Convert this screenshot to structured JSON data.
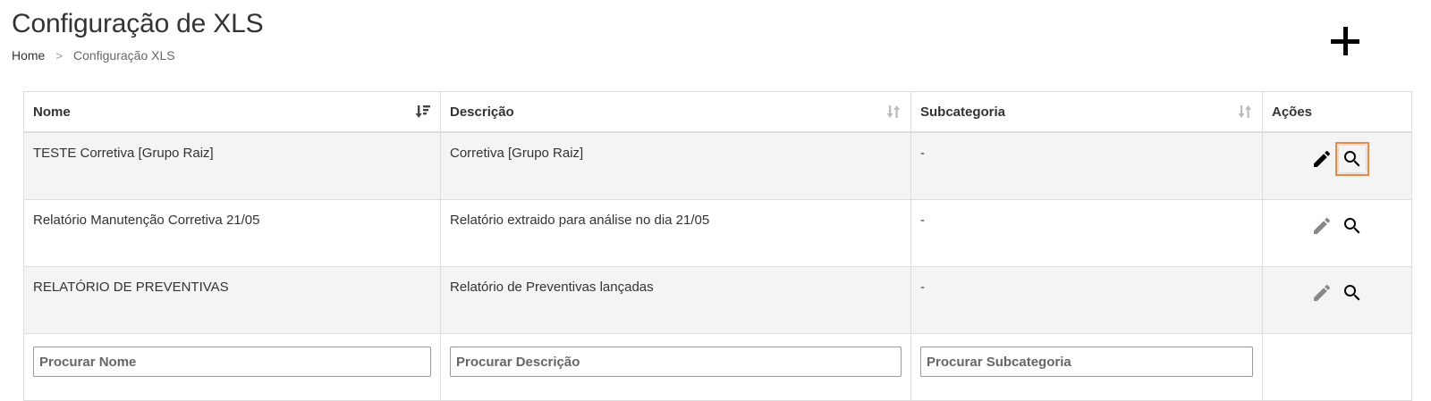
{
  "header": {
    "title": "Configuração de XLS",
    "breadcrumb": {
      "home": "Home",
      "separator": ">",
      "current": "Configuração XLS"
    }
  },
  "actions": {
    "add_icon": "plus-icon"
  },
  "table": {
    "columns": [
      {
        "label": "Nome",
        "sort": "sorted-descending"
      },
      {
        "label": "Descrição",
        "sort": "unsorted"
      },
      {
        "label": "Subcategoria",
        "sort": "unsorted"
      },
      {
        "label": "Ações",
        "sort": "none"
      }
    ],
    "rows": [
      {
        "nome": "TESTE Corretiva [Grupo Raiz]",
        "descricao": "Corretiva [Grupo Raiz]",
        "subcategoria": "-"
      },
      {
        "nome": "Relatório Manutenção Corretiva 21/05",
        "descricao": "Relatório extraido para análise no dia 21/05",
        "subcategoria": "-"
      },
      {
        "nome": "RELATÓRIO DE PREVENTIVAS",
        "descricao": "Relatório de Preventivas lançadas",
        "subcategoria": "-"
      }
    ],
    "row_actions": {
      "edit_icon": "pencil-icon",
      "view_icon": "search-icon"
    },
    "filters": {
      "nome_placeholder": "Procurar Nome",
      "descricao_placeholder": "Procurar Descrição",
      "subcategoria_placeholder": "Procurar Subcategoria"
    }
  },
  "colors": {
    "row_striped": "#f4f4f4",
    "border": "#dddddd",
    "edit_active": "#000000",
    "edit_disabled": "#888888",
    "focus_highlight": "#e8884a"
  }
}
